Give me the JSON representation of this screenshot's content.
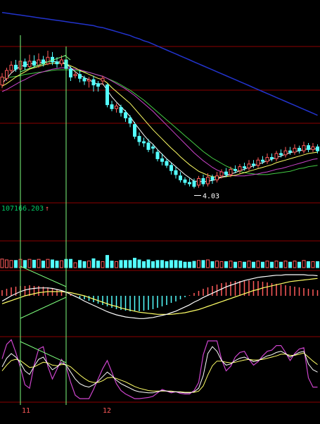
{
  "chart_data": {
    "type": "line",
    "colors": {
      "background": "#000000",
      "divider": "#8b0000",
      "up": "#ff5a5a",
      "down": "#54ffff",
      "ma_short": "#ffffff",
      "ma_mid": "#ffff66",
      "ma_long": "#cc44cc",
      "ma_longer": "#44cc44",
      "ma_longest": "#2233cc",
      "annotation": "#7cfc7c",
      "volume_value": "#00cc66"
    },
    "x_labels": [
      "11",
      "12"
    ],
    "low_price_label": "4.03",
    "volume_value_label": "107166.203",
    "volume_arrow": "↑",
    "candles": [
      {
        "i": 0,
        "o": 5.6,
        "c": 5.72,
        "h": 5.78,
        "l": 5.55
      },
      {
        "i": 1,
        "o": 5.7,
        "c": 5.82,
        "h": 5.86,
        "l": 5.66
      },
      {
        "i": 2,
        "o": 5.82,
        "c": 5.9,
        "h": 5.96,
        "l": 5.78
      },
      {
        "i": 3,
        "o": 5.9,
        "c": 5.84,
        "h": 5.98,
        "l": 5.8
      },
      {
        "i": 4,
        "o": 5.84,
        "c": 5.96,
        "h": 6.02,
        "l": 5.8
      },
      {
        "i": 5,
        "o": 5.95,
        "c": 5.88,
        "h": 6.0,
        "l": 5.82
      },
      {
        "i": 6,
        "o": 5.88,
        "c": 5.96,
        "h": 6.06,
        "l": 5.84
      },
      {
        "i": 7,
        "o": 5.96,
        "c": 5.9,
        "h": 6.05,
        "l": 5.86
      },
      {
        "i": 8,
        "o": 5.9,
        "c": 5.98,
        "h": 6.08,
        "l": 5.86
      },
      {
        "i": 9,
        "o": 5.98,
        "c": 5.92,
        "h": 6.04,
        "l": 5.88
      },
      {
        "i": 10,
        "o": 5.92,
        "c": 6.02,
        "h": 6.12,
        "l": 5.9
      },
      {
        "i": 11,
        "o": 6.02,
        "c": 5.95,
        "h": 6.1,
        "l": 5.9
      },
      {
        "i": 12,
        "o": 5.95,
        "c": 5.92,
        "h": 6.02,
        "l": 5.86
      },
      {
        "i": 13,
        "o": 5.92,
        "c": 5.98,
        "h": 6.05,
        "l": 5.88
      },
      {
        "i": 14,
        "o": 5.98,
        "c": 5.85,
        "h": 6.02,
        "l": 5.8
      },
      {
        "i": 15,
        "o": 5.84,
        "c": 5.72,
        "h": 5.88,
        "l": 5.66
      },
      {
        "i": 16,
        "o": 5.74,
        "c": 5.76,
        "h": 5.8,
        "l": 5.7
      },
      {
        "i": 17,
        "o": 5.76,
        "c": 5.7,
        "h": 5.82,
        "l": 5.64
      },
      {
        "i": 18,
        "o": 5.7,
        "c": 5.66,
        "h": 5.74,
        "l": 5.6
      },
      {
        "i": 19,
        "o": 5.66,
        "c": 5.68,
        "h": 5.72,
        "l": 5.56
      },
      {
        "i": 20,
        "o": 5.68,
        "c": 5.6,
        "h": 5.74,
        "l": 5.5
      },
      {
        "i": 21,
        "o": 5.62,
        "c": 5.58,
        "h": 5.66,
        "l": 5.5
      },
      {
        "i": 22,
        "o": 5.66,
        "c": 5.7,
        "h": 5.74,
        "l": 5.6
      },
      {
        "i": 23,
        "o": 5.6,
        "c": 5.3,
        "h": 5.62,
        "l": 5.26
      },
      {
        "i": 24,
        "o": 5.3,
        "c": 5.24,
        "h": 5.36,
        "l": 5.2
      },
      {
        "i": 25,
        "o": 5.24,
        "c": 5.28,
        "h": 5.32,
        "l": 5.18
      },
      {
        "i": 26,
        "o": 5.26,
        "c": 5.18,
        "h": 5.3,
        "l": 5.12
      },
      {
        "i": 27,
        "o": 5.18,
        "c": 5.1,
        "h": 5.22,
        "l": 5.04
      },
      {
        "i": 28,
        "o": 5.1,
        "c": 5.02,
        "h": 5.14,
        "l": 4.96
      },
      {
        "i": 29,
        "o": 5.0,
        "c": 4.82,
        "h": 5.04,
        "l": 4.78
      },
      {
        "i": 30,
        "o": 4.82,
        "c": 4.74,
        "h": 4.88,
        "l": 4.68
      },
      {
        "i": 31,
        "o": 4.74,
        "c": 4.72,
        "h": 4.8,
        "l": 4.66
      },
      {
        "i": 32,
        "o": 4.72,
        "c": 4.62,
        "h": 4.78,
        "l": 4.58
      },
      {
        "i": 33,
        "o": 4.66,
        "c": 4.64,
        "h": 4.7,
        "l": 4.56
      },
      {
        "i": 34,
        "o": 4.58,
        "c": 4.48,
        "h": 4.62,
        "l": 4.44
      },
      {
        "i": 35,
        "o": 4.48,
        "c": 4.44,
        "h": 4.56,
        "l": 4.38
      },
      {
        "i": 36,
        "o": 4.44,
        "c": 4.38,
        "h": 4.48,
        "l": 4.34
      },
      {
        "i": 37,
        "o": 4.38,
        "c": 4.3,
        "h": 4.42,
        "l": 4.24
      },
      {
        "i": 38,
        "o": 4.3,
        "c": 4.24,
        "h": 4.36,
        "l": 4.18
      },
      {
        "i": 39,
        "o": 4.22,
        "c": 4.16,
        "h": 4.28,
        "l": 4.12
      },
      {
        "i": 40,
        "o": 4.16,
        "c": 4.12,
        "h": 4.2,
        "l": 4.08
      },
      {
        "i": 41,
        "o": 4.12,
        "c": 4.1,
        "h": 4.18,
        "l": 4.06
      },
      {
        "i": 42,
        "o": 4.14,
        "c": 4.06,
        "h": 4.18,
        "l": 4.03
      },
      {
        "i": 43,
        "o": 4.08,
        "c": 4.18,
        "h": 4.22,
        "l": 4.04
      },
      {
        "i": 44,
        "o": 4.18,
        "c": 4.1,
        "h": 4.24,
        "l": 4.06
      },
      {
        "i": 45,
        "o": 4.1,
        "c": 4.2,
        "h": 4.26,
        "l": 4.06
      },
      {
        "i": 46,
        "o": 4.2,
        "c": 4.16,
        "h": 4.24,
        "l": 4.1
      },
      {
        "i": 47,
        "o": 4.16,
        "c": 4.22,
        "h": 4.28,
        "l": 4.12
      },
      {
        "i": 48,
        "o": 4.22,
        "c": 4.28,
        "h": 4.32,
        "l": 4.18
      },
      {
        "i": 49,
        "o": 4.28,
        "c": 4.24,
        "h": 4.34,
        "l": 4.2
      },
      {
        "i": 50,
        "o": 4.24,
        "c": 4.32,
        "h": 4.36,
        "l": 4.2
      },
      {
        "i": 51,
        "o": 4.32,
        "c": 4.3,
        "h": 4.38,
        "l": 4.26
      },
      {
        "i": 52,
        "o": 4.3,
        "c": 4.36,
        "h": 4.4,
        "l": 4.26
      },
      {
        "i": 53,
        "o": 4.36,
        "c": 4.34,
        "h": 4.42,
        "l": 4.3
      },
      {
        "i": 54,
        "o": 4.34,
        "c": 4.4,
        "h": 4.46,
        "l": 4.3
      },
      {
        "i": 55,
        "o": 4.4,
        "c": 4.38,
        "h": 4.46,
        "l": 4.34
      },
      {
        "i": 56,
        "o": 4.38,
        "c": 4.46,
        "h": 4.5,
        "l": 4.34
      },
      {
        "i": 57,
        "o": 4.46,
        "c": 4.44,
        "h": 4.52,
        "l": 4.4
      },
      {
        "i": 58,
        "o": 4.44,
        "c": 4.5,
        "h": 4.56,
        "l": 4.4
      },
      {
        "i": 59,
        "o": 4.5,
        "c": 4.48,
        "h": 4.56,
        "l": 4.44
      },
      {
        "i": 60,
        "o": 4.48,
        "c": 4.56,
        "h": 4.6,
        "l": 4.44
      },
      {
        "i": 61,
        "o": 4.56,
        "c": 4.54,
        "h": 4.62,
        "l": 4.5
      },
      {
        "i": 62,
        "o": 4.54,
        "c": 4.6,
        "h": 4.66,
        "l": 4.5
      },
      {
        "i": 63,
        "o": 4.6,
        "c": 4.58,
        "h": 4.66,
        "l": 4.54
      },
      {
        "i": 64,
        "o": 4.58,
        "c": 4.64,
        "h": 4.7,
        "l": 4.54
      },
      {
        "i": 65,
        "o": 4.64,
        "c": 4.6,
        "h": 4.68,
        "l": 4.56
      },
      {
        "i": 66,
        "o": 4.6,
        "c": 4.68,
        "h": 4.74,
        "l": 4.56
      },
      {
        "i": 67,
        "o": 4.68,
        "c": 4.62,
        "h": 4.72,
        "l": 4.58
      },
      {
        "i": 68,
        "o": 4.62,
        "c": 4.66,
        "h": 4.72,
        "l": 4.58
      },
      {
        "i": 69,
        "o": 4.66,
        "c": 4.6,
        "h": 4.7,
        "l": 4.56
      }
    ],
    "ma_short": [
      5.62,
      5.7,
      5.78,
      5.84,
      5.88,
      5.9,
      5.92,
      5.93,
      5.94,
      5.94,
      5.96,
      5.96,
      5.95,
      5.95,
      5.92,
      5.86,
      5.8,
      5.75,
      5.71,
      5.68,
      5.64,
      5.61,
      5.62,
      5.52,
      5.42,
      5.34,
      5.27,
      5.2,
      5.12,
      5.02,
      4.93,
      4.84,
      4.76,
      4.7,
      4.62,
      4.55,
      4.48,
      4.42,
      4.36,
      4.3,
      4.24,
      4.19,
      4.14,
      4.14,
      4.13,
      4.14,
      4.15,
      4.17,
      4.2,
      4.22,
      4.25,
      4.27,
      4.3,
      4.32,
      4.35,
      4.37,
      4.4,
      4.42,
      4.45,
      4.47,
      4.5,
      4.52,
      4.55,
      4.57,
      4.59,
      4.6,
      4.62,
      4.63,
      4.63,
      4.63
    ],
    "ma_mid": [
      5.58,
      5.62,
      5.67,
      5.72,
      5.76,
      5.8,
      5.84,
      5.86,
      5.88,
      5.9,
      5.92,
      5.93,
      5.93,
      5.93,
      5.92,
      5.89,
      5.86,
      5.82,
      5.79,
      5.76,
      5.73,
      5.7,
      5.68,
      5.63,
      5.56,
      5.5,
      5.44,
      5.38,
      5.32,
      5.24,
      5.16,
      5.08,
      5.0,
      4.92,
      4.85,
      4.78,
      4.71,
      4.64,
      4.58,
      4.51,
      4.45,
      4.39,
      4.34,
      4.29,
      4.26,
      4.23,
      4.21,
      4.2,
      4.2,
      4.21,
      4.22,
      4.23,
      4.25,
      4.27,
      4.29,
      4.31,
      4.33,
      4.35,
      4.37,
      4.39,
      4.42,
      4.44,
      4.46,
      4.48,
      4.5,
      4.52,
      4.54,
      4.56,
      4.57,
      4.58
    ],
    "ma_long": [
      5.5,
      5.53,
      5.57,
      5.61,
      5.65,
      5.68,
      5.72,
      5.75,
      5.78,
      5.8,
      5.82,
      5.84,
      5.85,
      5.86,
      5.86,
      5.85,
      5.84,
      5.83,
      5.81,
      5.79,
      5.77,
      5.75,
      5.73,
      5.7,
      5.66,
      5.62,
      5.58,
      5.54,
      5.49,
      5.44,
      5.38,
      5.32,
      5.26,
      5.2,
      5.13,
      5.06,
      4.99,
      4.92,
      4.85,
      4.78,
      4.71,
      4.64,
      4.57,
      4.51,
      4.45,
      4.4,
      4.35,
      4.31,
      4.28,
      4.25,
      4.23,
      4.22,
      4.22,
      4.22,
      4.23,
      4.24,
      4.25,
      4.27,
      4.28,
      4.3,
      4.32,
      4.33,
      4.35,
      4.37,
      4.39,
      4.41,
      4.43,
      4.45,
      4.47,
      4.48
    ],
    "ma_longer": [
      5.7,
      5.71,
      5.72,
      5.73,
      5.74,
      5.76,
      5.77,
      5.78,
      5.79,
      5.8,
      5.81,
      5.82,
      5.83,
      5.83,
      5.83,
      5.83,
      5.82,
      5.81,
      5.8,
      5.79,
      5.77,
      5.75,
      5.73,
      5.7,
      5.67,
      5.64,
      5.6,
      5.56,
      5.52,
      5.47,
      5.42,
      5.37,
      5.31,
      5.25,
      5.19,
      5.13,
      5.07,
      5.01,
      4.95,
      4.89,
      4.83,
      4.77,
      4.71,
      4.65,
      4.59,
      4.54,
      4.49,
      4.45,
      4.41,
      4.37,
      4.34,
      4.31,
      4.29,
      4.27,
      4.26,
      4.25,
      4.24,
      4.24,
      4.24,
      4.25,
      4.26,
      4.27,
      4.28,
      4.29,
      4.31,
      4.33,
      4.34,
      4.36,
      4.37,
      4.38
    ],
    "ma_longest": [
      6.7,
      6.69,
      6.68,
      6.67,
      6.66,
      6.65,
      6.64,
      6.63,
      6.62,
      6.61,
      6.6,
      6.59,
      6.58,
      6.57,
      6.56,
      6.55,
      6.54,
      6.53,
      6.52,
      6.51,
      6.5,
      6.48,
      6.47,
      6.45,
      6.43,
      6.41,
      6.39,
      6.37,
      6.35,
      6.32,
      6.3,
      6.27,
      6.25,
      6.22,
      6.19,
      6.16,
      6.13,
      6.1,
      6.07,
      6.04,
      6.01,
      5.98,
      5.95,
      5.92,
      5.89,
      5.86,
      5.83,
      5.8,
      5.77,
      5.74,
      5.71,
      5.68,
      5.65,
      5.62,
      5.59,
      5.56,
      5.53,
      5.5,
      5.47,
      5.44,
      5.41,
      5.38,
      5.35,
      5.32,
      5.29,
      5.26,
      5.23,
      5.2,
      5.17,
      5.14
    ],
    "macd_hist": [
      0.08,
      0.1,
      0.12,
      0.13,
      0.14,
      0.14,
      0.15,
      0.14,
      0.14,
      0.13,
      0.12,
      0.11,
      0.09,
      0.07,
      0.05,
      0.02,
      -0.01,
      -0.03,
      -0.05,
      -0.07,
      -0.09,
      -0.11,
      -0.13,
      -0.15,
      -0.17,
      -0.19,
      -0.2,
      -0.21,
      -0.22,
      -0.22,
      -0.22,
      -0.21,
      -0.2,
      -0.19,
      -0.17,
      -0.15,
      -0.13,
      -0.1,
      -0.08,
      -0.05,
      -0.02,
      0.01,
      0.04,
      0.07,
      0.1,
      0.12,
      0.14,
      0.16,
      0.18,
      0.19,
      0.2,
      0.21,
      0.21,
      0.22,
      0.22,
      0.21,
      0.21,
      0.2,
      0.19,
      0.18,
      0.17,
      0.16,
      0.15,
      0.14,
      0.13,
      0.12,
      0.11,
      0.1,
      0.09,
      0.08
    ],
    "macd_dif": [
      -0.1,
      -0.05,
      0.0,
      0.04,
      0.08,
      0.11,
      0.13,
      0.14,
      0.15,
      0.15,
      0.15,
      0.14,
      0.12,
      0.1,
      0.07,
      0.03,
      -0.01,
      -0.05,
      -0.1,
      -0.14,
      -0.18,
      -0.22,
      -0.26,
      -0.3,
      -0.33,
      -0.36,
      -0.38,
      -0.4,
      -0.41,
      -0.42,
      -0.43,
      -0.43,
      -0.42,
      -0.41,
      -0.39,
      -0.37,
      -0.35,
      -0.32,
      -0.29,
      -0.25,
      -0.21,
      -0.17,
      -0.12,
      -0.08,
      -0.03,
      0.01,
      0.05,
      0.09,
      0.13,
      0.17,
      0.2,
      0.23,
      0.26,
      0.29,
      0.31,
      0.33,
      0.35,
      0.36,
      0.37,
      0.38,
      0.39,
      0.39,
      0.4,
      0.4,
      0.4,
      0.4,
      0.4,
      0.39,
      0.39,
      0.38
    ],
    "macd_dea": [
      -0.15,
      -0.12,
      -0.09,
      -0.06,
      -0.03,
      0.0,
      0.02,
      0.04,
      0.06,
      0.07,
      0.08,
      0.08,
      0.08,
      0.08,
      0.07,
      0.06,
      0.04,
      0.02,
      0.0,
      -0.03,
      -0.06,
      -0.09,
      -0.12,
      -0.15,
      -0.18,
      -0.2,
      -0.23,
      -0.25,
      -0.27,
      -0.29,
      -0.31,
      -0.32,
      -0.33,
      -0.34,
      -0.35,
      -0.35,
      -0.35,
      -0.35,
      -0.34,
      -0.33,
      -0.32,
      -0.3,
      -0.28,
      -0.26,
      -0.23,
      -0.2,
      -0.17,
      -0.14,
      -0.11,
      -0.08,
      -0.05,
      -0.02,
      0.01,
      0.04,
      0.07,
      0.1,
      0.12,
      0.15,
      0.17,
      0.19,
      0.21,
      0.23,
      0.25,
      0.27,
      0.28,
      0.29,
      0.3,
      0.31,
      0.32,
      0.33
    ],
    "kdj_k": [
      55,
      70,
      78,
      72,
      62,
      48,
      42,
      56,
      68,
      72,
      60,
      50,
      55,
      62,
      58,
      46,
      34,
      26,
      22,
      20,
      24,
      30,
      38,
      46,
      40,
      32,
      26,
      22,
      18,
      14,
      12,
      11,
      10,
      10,
      12,
      14,
      13,
      12,
      12,
      11,
      10,
      10,
      12,
      18,
      40,
      78,
      90,
      82,
      66,
      58,
      60,
      66,
      70,
      72,
      68,
      64,
      66,
      70,
      74,
      76,
      80,
      82,
      78,
      72,
      76,
      80,
      82,
      60,
      50,
      46
    ],
    "kdj_d": [
      48,
      58,
      66,
      68,
      66,
      60,
      54,
      55,
      59,
      63,
      62,
      58,
      57,
      59,
      59,
      55,
      48,
      41,
      35,
      30,
      28,
      28,
      31,
      36,
      37,
      35,
      32,
      29,
      25,
      21,
      18,
      16,
      14,
      13,
      13,
      13,
      13,
      13,
      12,
      12,
      11,
      11,
      11,
      13,
      22,
      41,
      57,
      65,
      65,
      63,
      62,
      63,
      65,
      67,
      68,
      67,
      67,
      68,
      70,
      72,
      74,
      77,
      77,
      75,
      75,
      77,
      79,
      72,
      65,
      59
    ],
    "kdj_j": [
      69,
      94,
      102,
      80,
      54,
      24,
      18,
      58,
      86,
      90,
      56,
      34,
      51,
      68,
      56,
      28,
      6,
      0,
      0,
      0,
      16,
      34,
      52,
      66,
      46,
      26,
      14,
      8,
      4,
      0,
      0,
      1,
      2,
      4,
      10,
      16,
      13,
      10,
      12,
      9,
      8,
      8,
      14,
      28,
      76,
      100,
      100,
      100,
      68,
      48,
      56,
      72,
      80,
      82,
      68,
      58,
      64,
      74,
      82,
      84,
      92,
      92,
      80,
      66,
      78,
      86,
      88,
      36,
      20,
      20
    ]
  }
}
